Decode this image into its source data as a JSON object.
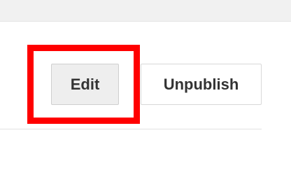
{
  "toolbar": {
    "edit_label": "Edit",
    "unpublish_label": "Unpublish"
  },
  "colors": {
    "highlight": "#ff0000",
    "button_bg": "#eeeeee",
    "text": "#333333"
  }
}
